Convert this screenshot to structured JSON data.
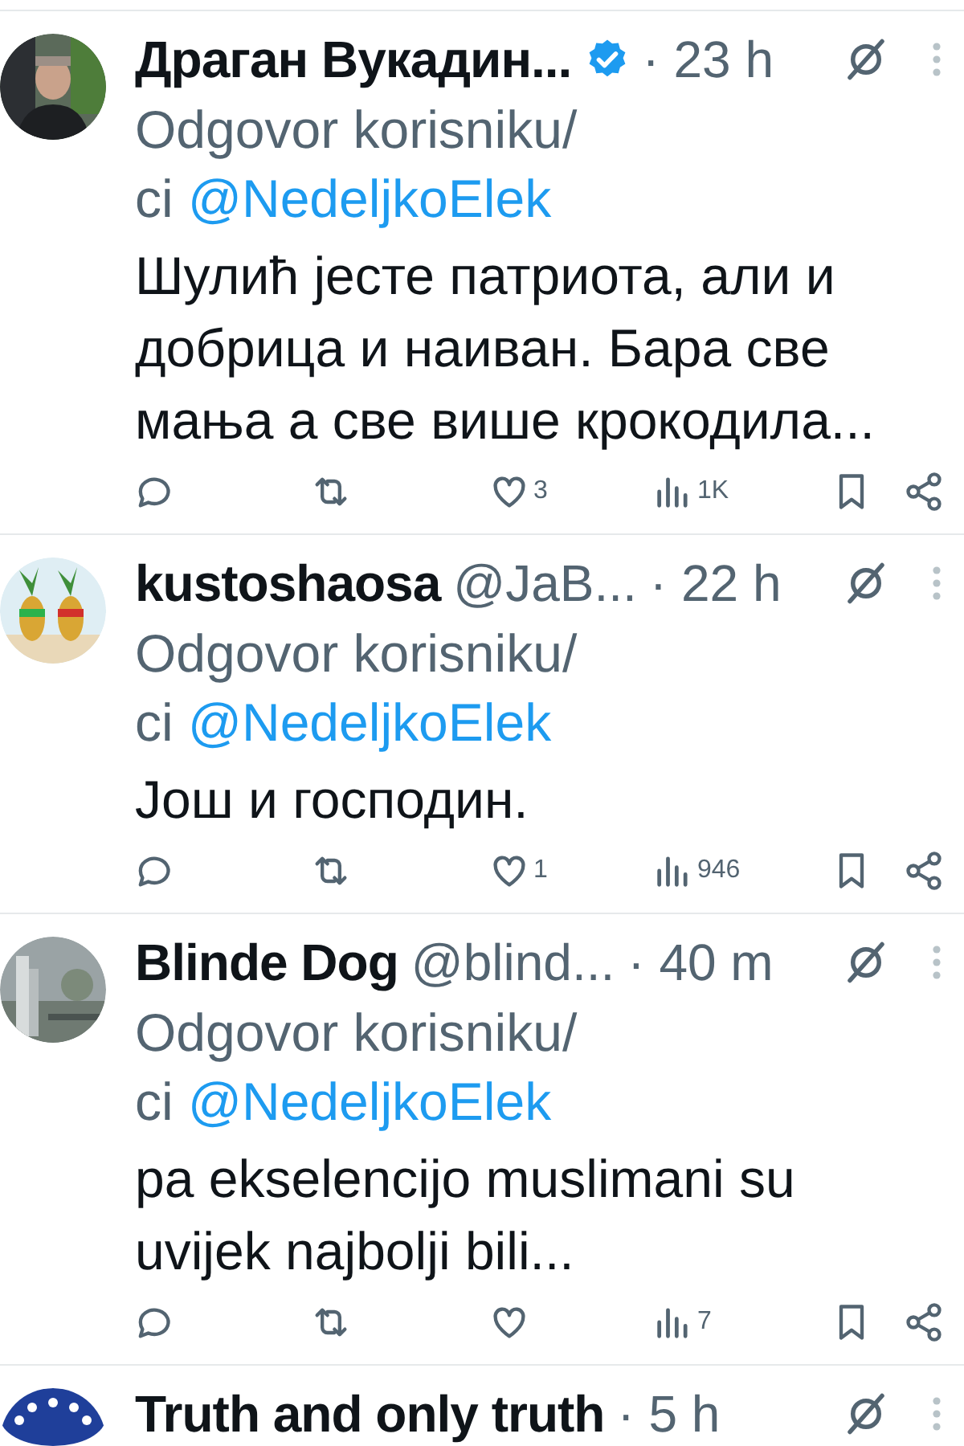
{
  "tweets": [
    {
      "name": "Драган Вукадин...",
      "verified": true,
      "time": "· 23 h",
      "reply_label": "Odgovor korisniku/ci",
      "reply_to": "@NedeljkoElek",
      "text": "Шулић јесте патриота, али и добрица и наиван. Бара све мања а све више крокодила...",
      "likes": "3",
      "views": "1K"
    },
    {
      "name": "kustoshaosa",
      "verified": false,
      "handle": "@JaB...",
      "time": "· 22 h",
      "reply_label": "Odgovor korisniku/ci",
      "reply_to": "@NedeljkoElek",
      "text": "Још и господин.",
      "likes": "1",
      "views": "946"
    },
    {
      "name": "Blinde Dog",
      "verified": false,
      "handle": "@blind...",
      "time": "· 40 m",
      "reply_label": "Odgovor korisniku/ci",
      "reply_to": "@NedeljkoElek",
      "text": "pa ekselencijo muslimani su uvijek najbolji bili...",
      "views": "7"
    },
    {
      "name": "Truth and only truth",
      "verified": false,
      "time": "· 5 h"
    }
  ]
}
